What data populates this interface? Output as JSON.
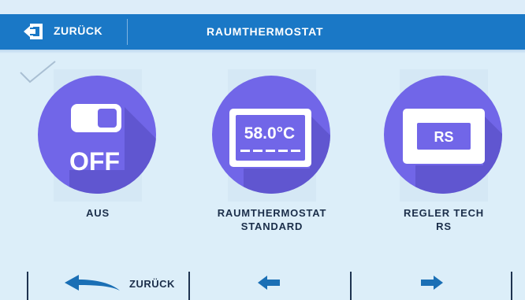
{
  "header": {
    "back_label": "ZURÜCK",
    "title": "RAUMTHERMOSTAT"
  },
  "options": [
    {
      "label_line1": "AUS",
      "label_line2": "",
      "icon_text": "OFF",
      "selected": true,
      "icon": "toggle-off-icon"
    },
    {
      "label_line1": "RAUMTHERMOSTAT",
      "label_line2": "STANDARD",
      "icon_text": "58.0°C",
      "selected": false,
      "icon": "thermostat-display-icon"
    },
    {
      "label_line1": "REGLER TECH",
      "label_line2": "RS",
      "icon_text": "RS",
      "selected": false,
      "icon": "regler-rs-icon"
    }
  ],
  "footer": {
    "back_label": "ZURÜCK",
    "prev_icon": "arrow-left-icon",
    "next_icon": "arrow-right-icon"
  },
  "colors": {
    "header_blue": "#1a78c6",
    "background": "#dceef9",
    "circle_purple": "#7166e8",
    "circle_shadow": "#5b52c8",
    "arrow_blue": "#1a6fb5",
    "text_dark": "#1b2e4a"
  }
}
